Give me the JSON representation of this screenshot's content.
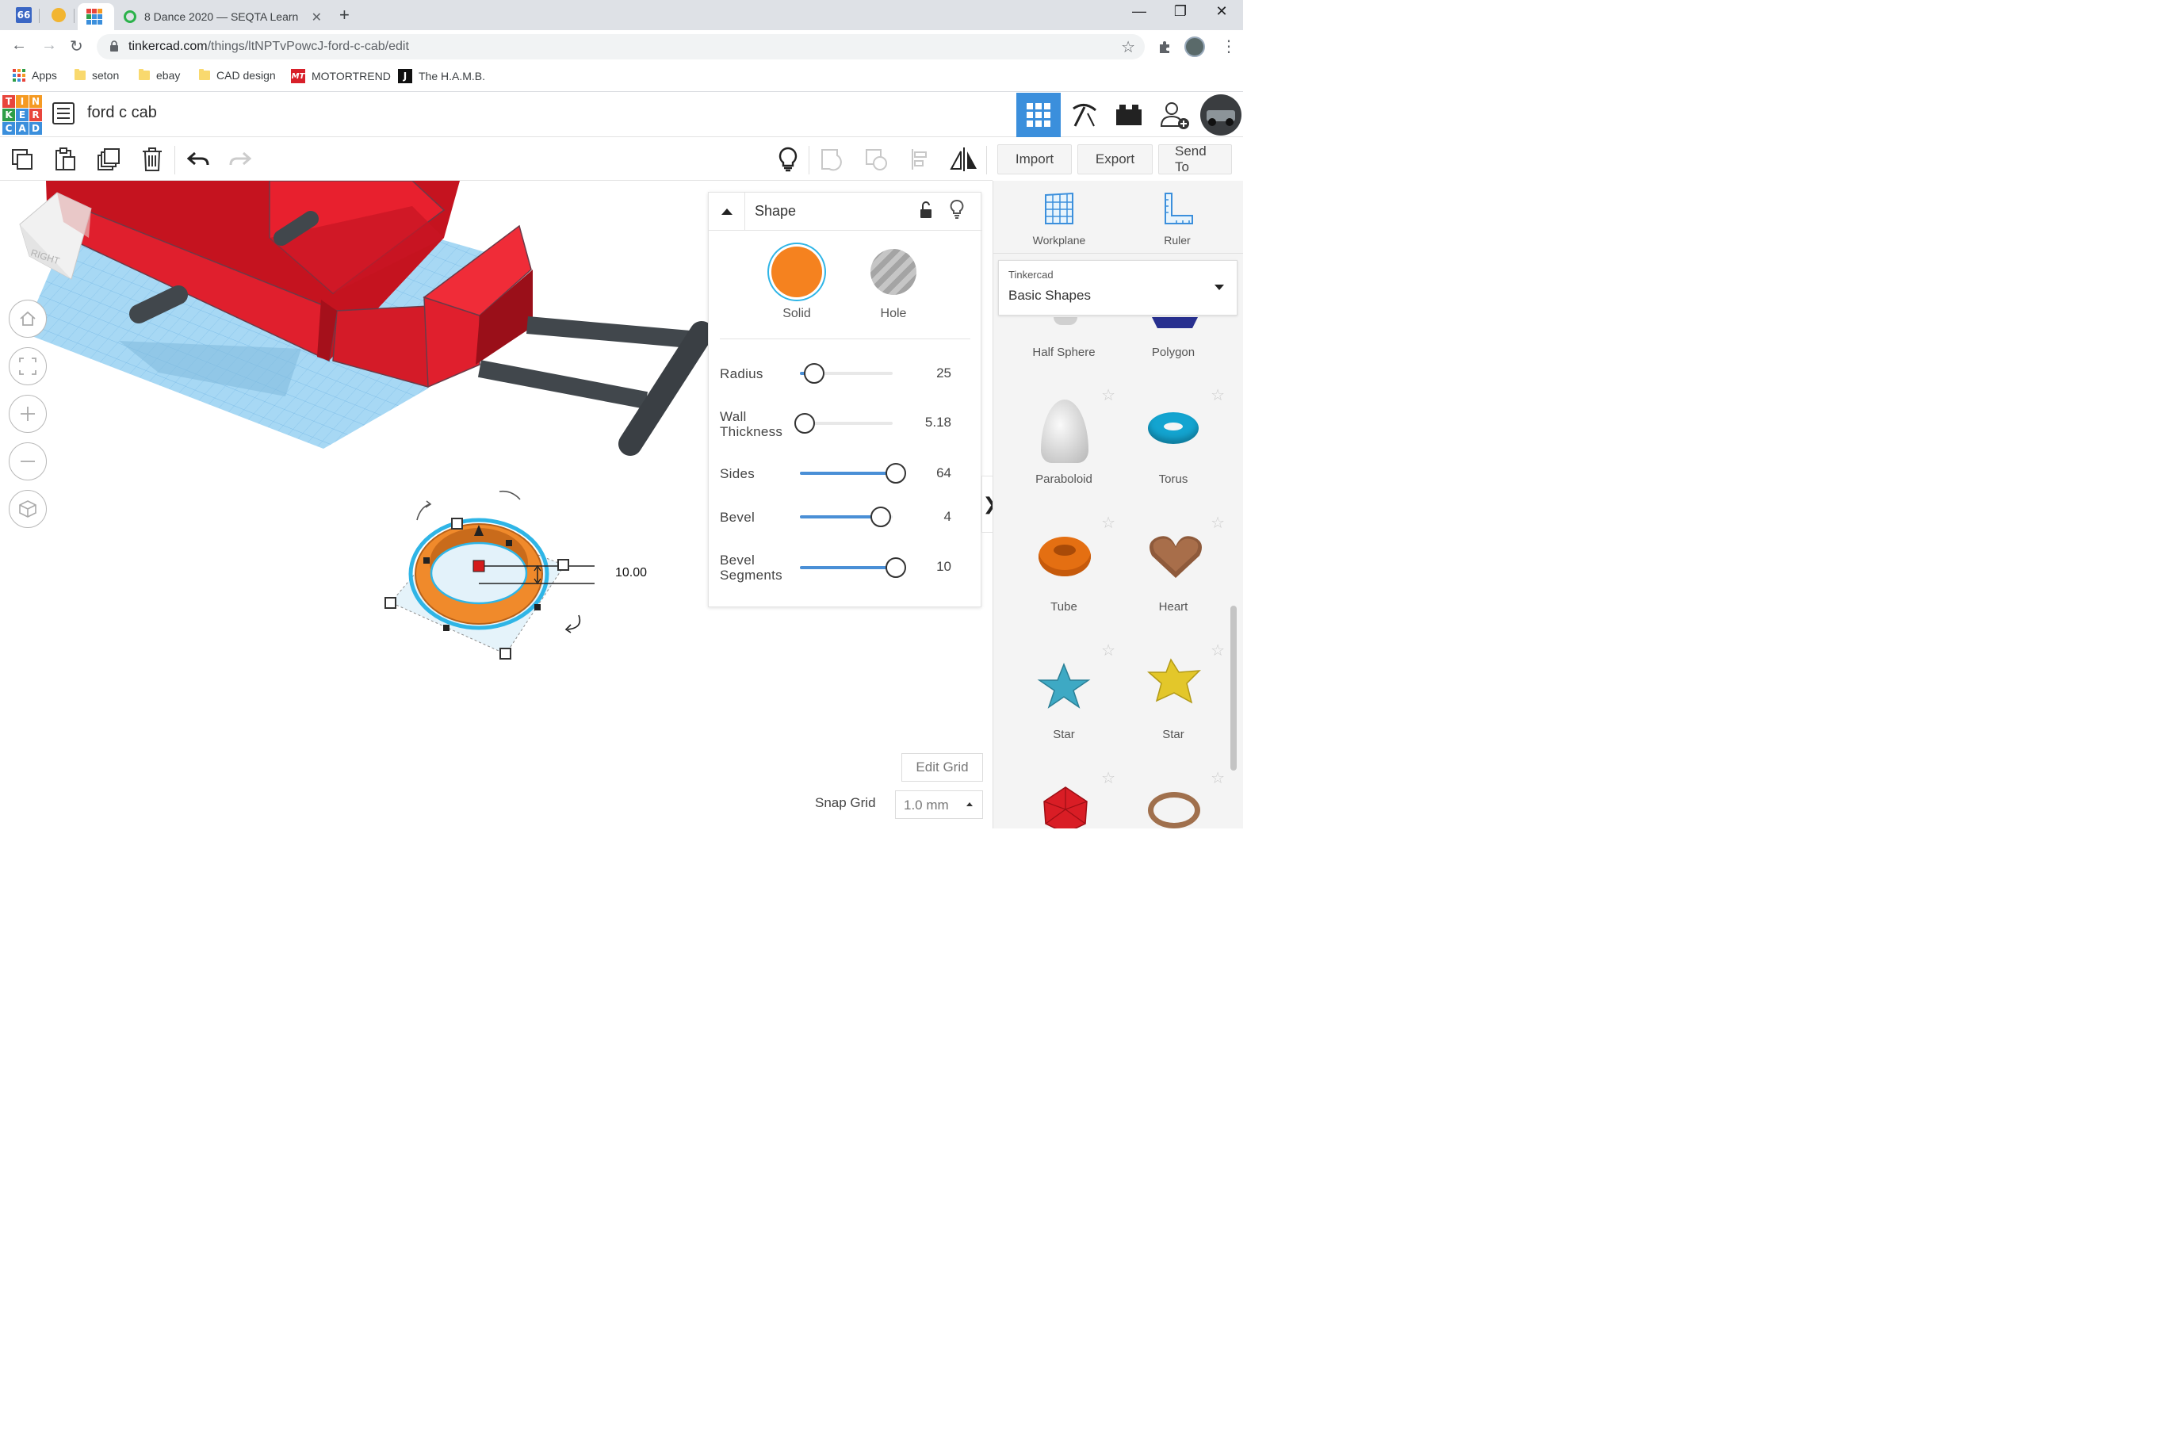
{
  "browser": {
    "tabs": [
      {
        "label": "8 Dance 2020 — SEQTA Learn"
      }
    ],
    "url_host": "tinkercad.com",
    "url_path": "/things/ltNPTvPowcJ-ford-c-cab/edit",
    "bookmarks": {
      "apps": "Apps",
      "seton": "seton",
      "ebay": "ebay",
      "cad": "CAD design",
      "motortrend": "MOTORTREND",
      "hamb": "The H.A.M.B."
    }
  },
  "app": {
    "logo_letters": [
      "T",
      "I",
      "N",
      "K",
      "E",
      "R",
      "C",
      "A",
      "D"
    ],
    "design_title": "ford c cab"
  },
  "toolbar": {
    "import_label": "Import",
    "export_label": "Export",
    "send_to_label": "Send To"
  },
  "viewcube": {
    "face_label": "RIGHT"
  },
  "workspace": {
    "dimension_value": "10.00"
  },
  "inspector": {
    "title": "Shape",
    "solid_label": "Solid",
    "hole_label": "Hole",
    "properties": [
      {
        "label": "Radius",
        "value": "25",
        "level": 0.12
      },
      {
        "label": "Wall\nThickness",
        "value": "5.18",
        "level": 0.02
      },
      {
        "label": "Sides",
        "value": "64",
        "level": 1.0
      },
      {
        "label": "Bevel",
        "value": "4",
        "level": 0.84
      },
      {
        "label": "Bevel\nSegments",
        "value": "10",
        "level": 1.0
      }
    ]
  },
  "right_panel": {
    "workplane_label": "Workplane",
    "ruler_label": "Ruler",
    "library_source": "Tinkercad",
    "library_name": "Basic Shapes",
    "shapes": [
      "Half Sphere",
      "Polygon",
      "Paraboloid",
      "Torus",
      "Tube",
      "Heart",
      "Star",
      "Star"
    ]
  },
  "grid": {
    "edit_grid_label": "Edit Grid",
    "snap_label": "Snap Grid",
    "snap_value": "1.0 mm"
  },
  "colors": {
    "solid": "#f5821f",
    "selection": "#2fb5e6",
    "model_red": "#e01f2d",
    "workplane": "#9fd5f2",
    "active_view": "#3b8fdc"
  }
}
